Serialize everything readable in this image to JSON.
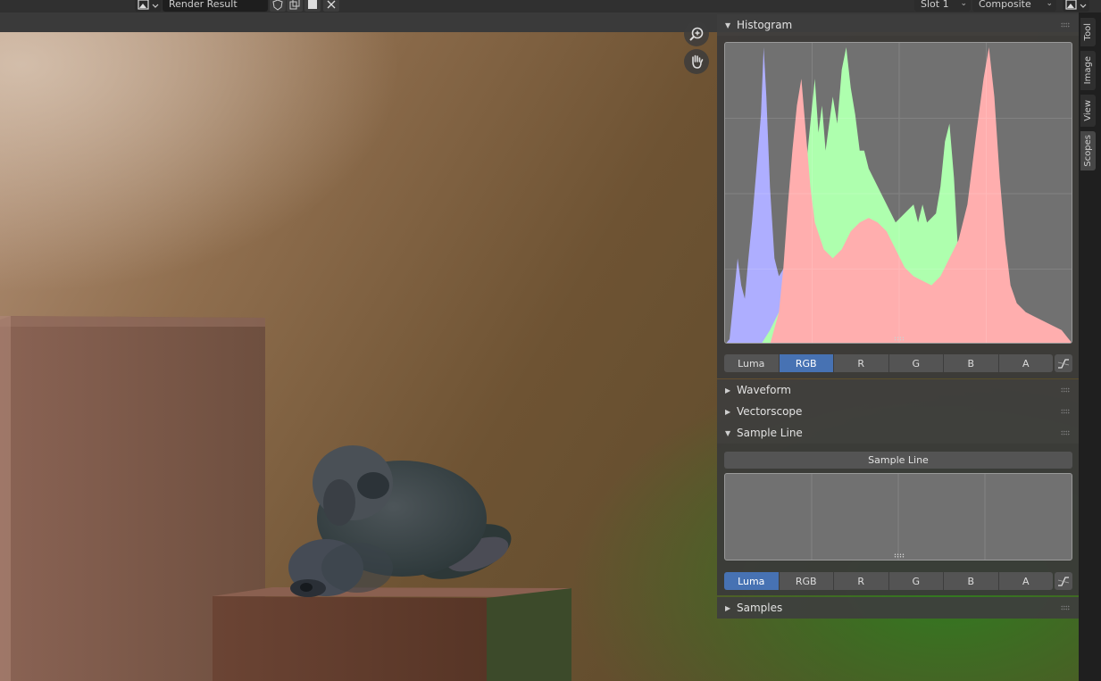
{
  "header": {
    "image_name": "Render Result",
    "slot": "Slot 1",
    "layer": "Composite"
  },
  "sidebar": {
    "tabs": [
      {
        "label": "Tool"
      },
      {
        "label": "Image"
      },
      {
        "label": "View"
      },
      {
        "label": "Scopes",
        "active": true
      }
    ],
    "panels": {
      "histogram": {
        "title": "Histogram",
        "expanded": true
      },
      "waveform": {
        "title": "Waveform",
        "expanded": false
      },
      "vectorscope": {
        "title": "Vectorscope",
        "expanded": false
      },
      "sample_line": {
        "title": "Sample Line",
        "expanded": true,
        "button": "Sample Line"
      },
      "samples": {
        "title": "Samples",
        "expanded": false
      }
    },
    "histogram_modes": [
      {
        "label": "Luma",
        "active": false
      },
      {
        "label": "RGB",
        "active": true
      },
      {
        "label": "R",
        "active": false
      },
      {
        "label": "G",
        "active": false
      },
      {
        "label": "B",
        "active": false
      },
      {
        "label": "A",
        "active": false
      }
    ],
    "sample_line_modes": [
      {
        "label": "Luma",
        "active": true
      },
      {
        "label": "RGB",
        "active": false
      },
      {
        "label": "R",
        "active": false
      },
      {
        "label": "G",
        "active": false
      },
      {
        "label": "B",
        "active": false
      },
      {
        "label": "A",
        "active": false
      }
    ]
  },
  "colors": {
    "active_toggle": "#4772b3",
    "histogram_red": "#ff6e6e",
    "histogram_green": "#6eff6e",
    "histogram_blue": "#6e6eff"
  }
}
